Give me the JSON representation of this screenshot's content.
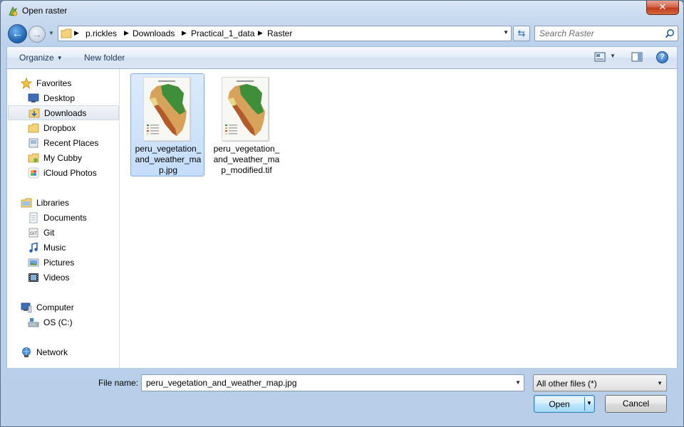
{
  "window": {
    "title": "Open raster",
    "close_label": "✕"
  },
  "address": {
    "breadcrumbs": [
      "p.rickles",
      "Downloads",
      "Practical_1_data",
      "Raster"
    ]
  },
  "search": {
    "placeholder": "Search Raster"
  },
  "toolbar": {
    "organize_label": "Organize",
    "new_folder_label": "New folder",
    "help_label": "?"
  },
  "sidebar": {
    "favorites": {
      "label": "Favorites",
      "items": [
        {
          "label": "Desktop",
          "icon": "desktop-icon"
        },
        {
          "label": "Downloads",
          "icon": "downloads-folder-icon",
          "selected": true
        },
        {
          "label": "Dropbox",
          "icon": "dropbox-folder-icon"
        },
        {
          "label": "Recent Places",
          "icon": "recent-places-icon"
        },
        {
          "label": "My Cubby",
          "icon": "cubby-icon"
        },
        {
          "label": "iCloud Photos",
          "icon": "icloud-photos-icon"
        }
      ]
    },
    "libraries": {
      "label": "Libraries",
      "items": [
        {
          "label": "Documents",
          "icon": "documents-icon"
        },
        {
          "label": "Git",
          "icon": "git-icon"
        },
        {
          "label": "Music",
          "icon": "music-icon"
        },
        {
          "label": "Pictures",
          "icon": "pictures-icon"
        },
        {
          "label": "Videos",
          "icon": "videos-icon"
        }
      ]
    },
    "computer": {
      "label": "Computer",
      "items": [
        {
          "label": "OS (C:)",
          "icon": "drive-icon"
        }
      ]
    },
    "network": {
      "label": "Network"
    }
  },
  "files": [
    {
      "name": "peru_vegetation_and_weather_map.jpg",
      "name_lines": [
        "peru_vegetation_",
        "and_weather_ma",
        "p.jpg"
      ],
      "selected": true
    },
    {
      "name": "peru_vegetation_and_weather_map_modified.tif",
      "name_lines": [
        "peru_vegetation_",
        "and_weather_ma",
        "p_modified.tif"
      ],
      "selected": false
    }
  ],
  "bottom": {
    "file_name_label": "File name:",
    "file_name_value": "peru_vegetation_and_weather_map.jpg",
    "filter_value": "All other files (*)",
    "open_label": "Open",
    "cancel_label": "Cancel"
  },
  "colors": {
    "accent": "#2469b6",
    "selection": "#c4ddfb"
  }
}
